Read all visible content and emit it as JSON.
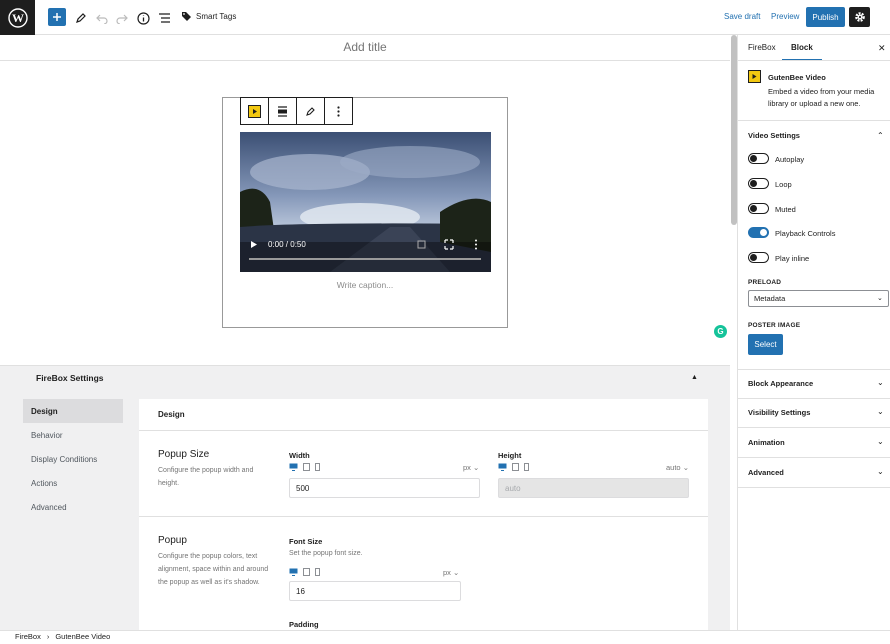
{
  "toolbar": {
    "smart_tags": "Smart Tags",
    "save_draft": "Save draft",
    "preview": "Preview",
    "publish": "Publish"
  },
  "editor": {
    "title_placeholder": "Add title",
    "video_time": "0:00 / 0:50",
    "caption_placeholder": "Write caption...",
    "grammarly_letter": "G"
  },
  "firebox": {
    "header": "FireBox Settings",
    "nav": [
      "Design",
      "Behavior",
      "Display Conditions",
      "Actions",
      "Advanced"
    ],
    "card_title": "Design",
    "popup_size": {
      "title": "Popup Size",
      "description": "Configure the popup width and height.",
      "width_label": "Width",
      "width_unit": "px",
      "width_value": "500",
      "height_label": "Height",
      "height_unit": "auto",
      "height_value": "auto"
    },
    "popup": {
      "title": "Popup",
      "description": "Configure the popup colors, text alignment, space within and around the popup as well as it's shadow.",
      "font_size_label": "Font Size",
      "font_size_help": "Set the popup font size.",
      "font_size_unit": "px",
      "font_size_value": "16",
      "padding_label": "Padding"
    }
  },
  "breadcrumb": [
    "FireBox",
    "GutenBee Video"
  ],
  "sidebar": {
    "tabs": [
      "FireBox",
      "Block"
    ],
    "block_name": "GutenBee Video",
    "block_desc": "Embed a video from your media library or upload a new one.",
    "video_settings": "Video Settings",
    "toggles": [
      {
        "label": "Autoplay",
        "on": false
      },
      {
        "label": "Loop",
        "on": false
      },
      {
        "label": "Muted",
        "on": false
      },
      {
        "label": "Playback Controls",
        "on": true
      },
      {
        "label": "Play inline",
        "on": false
      }
    ],
    "preload_label": "PRELOAD",
    "preload_value": "Metadata",
    "poster_label": "POSTER IMAGE",
    "select_button": "Select",
    "panels": [
      "Block Appearance",
      "Visibility Settings",
      "Animation",
      "Advanced"
    ]
  },
  "colors": {
    "accent": "#2271b1",
    "dark": "#1e1e1e",
    "block_icon": "#f2c811",
    "grammarly": "#15c39a"
  }
}
